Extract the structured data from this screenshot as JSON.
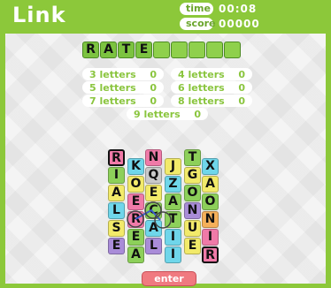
{
  "app": {
    "title": "Link"
  },
  "hud": {
    "time_label": "time",
    "time_value": "00:08",
    "score_label": "score",
    "score_value": "00000"
  },
  "current_word": {
    "letters": [
      "R",
      "A",
      "T",
      "E",
      "",
      "",
      "",
      "",
      ""
    ]
  },
  "counters": [
    {
      "label": "3 letters",
      "value": "0"
    },
    {
      "label": "4 letters",
      "value": "0"
    },
    {
      "label": "5 letters",
      "value": "0"
    },
    {
      "label": "6 letters",
      "value": "0"
    },
    {
      "label": "7 letters",
      "value": "0"
    },
    {
      "label": "8 letters",
      "value": "0"
    },
    {
      "label": "9 letters",
      "value": "0"
    }
  ],
  "board": {
    "columns": [
      [
        "R",
        "I",
        "A",
        "L",
        "S",
        "E"
      ],
      [
        "K",
        "O",
        "E",
        "R",
        "E",
        "A"
      ],
      [
        "N",
        "Q",
        "E",
        "C",
        "A",
        "L"
      ],
      [
        "J",
        "Z",
        "A",
        "T",
        "I",
        "I"
      ],
      [
        "T",
        "G",
        "O",
        "N",
        "U",
        "E"
      ],
      [
        "X",
        "A",
        "O",
        "N",
        "I",
        "R"
      ]
    ],
    "colors": {
      "pink": "#f07aa8",
      "green": "#8dd05a",
      "yellow": "#f2ea6a",
      "cyan": "#6fd6ea",
      "violet": "#a98cd8",
      "orange": "#f5b05a",
      "gray": "#c9c9c9"
    }
  },
  "buttons": {
    "enter": "enter"
  }
}
